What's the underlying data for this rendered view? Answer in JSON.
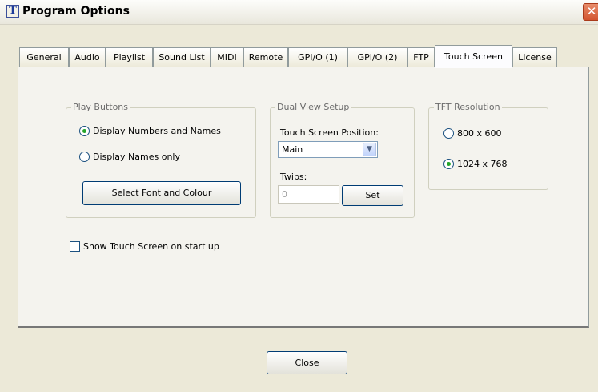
{
  "window": {
    "title": "Program Options",
    "icon": "app-letter-icon",
    "icon_letter": "T"
  },
  "tabs": [
    {
      "label": "General"
    },
    {
      "label": "Audio"
    },
    {
      "label": "Playlist"
    },
    {
      "label": "Sound List"
    },
    {
      "label": "MIDI"
    },
    {
      "label": "Remote"
    },
    {
      "label": "GPI/O (1)"
    },
    {
      "label": "GPI/O (2)"
    },
    {
      "label": "FTP"
    },
    {
      "label": "Touch Screen"
    },
    {
      "label": "License"
    }
  ],
  "active_tab": "Touch Screen",
  "play_buttons": {
    "label": "Play Buttons",
    "option_numbers_names": "Display Numbers and Names",
    "option_names_only": "Display Names only",
    "selected": "Display Numbers and Names",
    "font_button": "Select Font and Colour"
  },
  "dual_view": {
    "label": "Dual View Setup",
    "position_label": "Touch Screen Position:",
    "position_value": "Main",
    "twips_label": "Twips:",
    "twips_value": "0",
    "set_button": "Set"
  },
  "tft_resolution": {
    "label": "TFT Resolution",
    "option_800": "800 x 600",
    "option_1024": "1024 x 768",
    "selected": "1024 x 768"
  },
  "startup_checkbox": {
    "label": "Show Touch Screen on start up",
    "checked": false
  },
  "close_button": "Close",
  "colors": {
    "accent": "#003c74",
    "radio_dot": "#24a52b",
    "close_x": "#d2542f"
  }
}
